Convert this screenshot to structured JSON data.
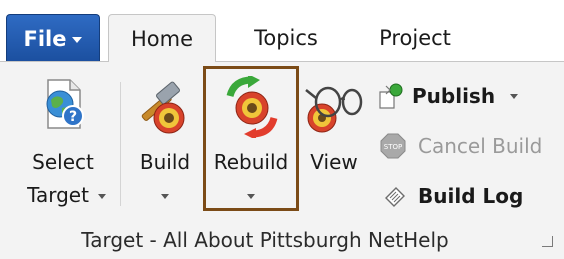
{
  "tabs": {
    "file": "File",
    "home": "Home",
    "topics": "Topics",
    "project": "Project"
  },
  "buttons": {
    "select_target_line1": "Select",
    "select_target_line2": "Target",
    "build": "Build",
    "rebuild": "Rebuild",
    "view": "View",
    "publish": "Publish",
    "cancel_build": "Cancel Build",
    "build_log": "Build Log"
  },
  "group": {
    "label": "Target - All About Pittsburgh NetHelp"
  },
  "colors": {
    "file_tab": "#1e56a8",
    "highlight_border": "#7b4b17"
  }
}
